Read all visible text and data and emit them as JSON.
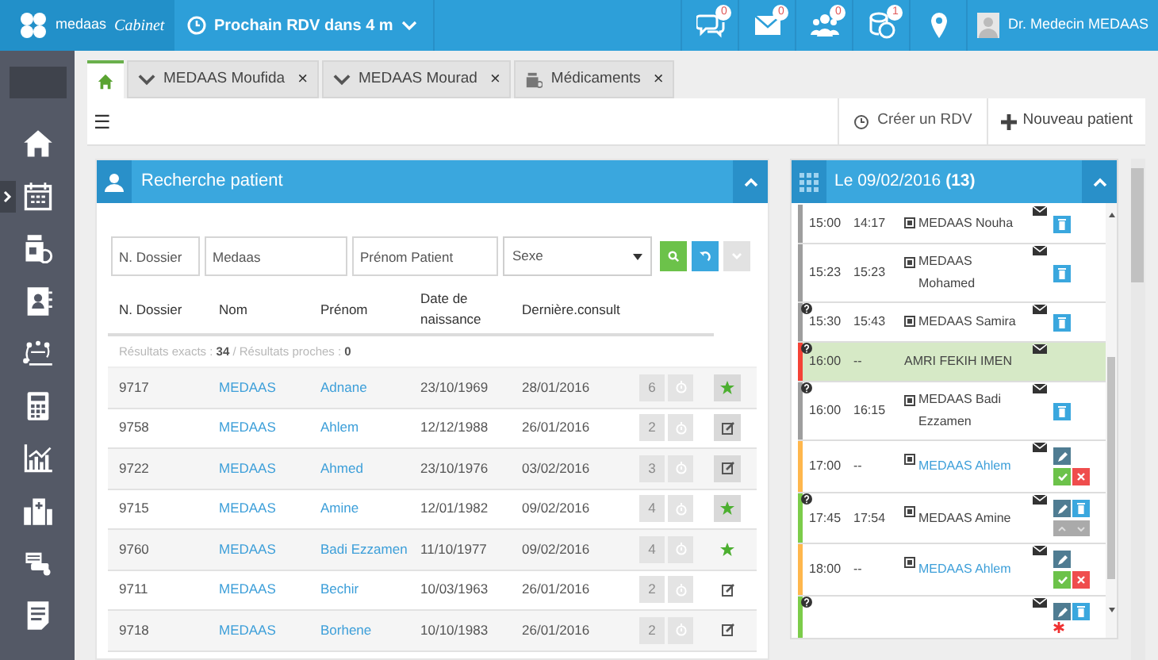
{
  "topbar": {
    "logo_text": "medaas",
    "logo_script": "Cabinet",
    "next_appointment": "Prochain RDV dans 4 m",
    "notifications": [
      {
        "kind": "chat",
        "count": "0"
      },
      {
        "kind": "mail",
        "count": "0"
      },
      {
        "kind": "group",
        "count": "0"
      },
      {
        "kind": "coins",
        "count": "1"
      },
      {
        "kind": "pin"
      }
    ],
    "user": "Dr. Medecin MEDAAS"
  },
  "tabs": [
    {
      "kind": "home",
      "selected": true
    },
    {
      "kind": "patient",
      "label": "MEDAAS Moufida",
      "close": "×",
      "selected": false
    },
    {
      "kind": "patient",
      "label": "MEDAAS Mourad",
      "close": "×",
      "selected": false
    },
    {
      "kind": "drug",
      "label": "Médicaments",
      "close": "×",
      "selected": false
    }
  ],
  "toolbar": {
    "menu": "☰",
    "create": "Créer un RDV",
    "new_patient": "Nouveau patient"
  },
  "search_panel": {
    "title": "Recherche patient",
    "fields": [
      {
        "placeholder": "N. Dossier"
      },
      {
        "value": "Medaas"
      },
      {
        "placeholder": "Prénom Patient"
      }
    ],
    "select": "Sexe",
    "columns": [
      "N. Dossier",
      "Nom",
      "Prénom",
      "Date de naissance",
      "Dernière.consult"
    ],
    "results": "Résultats exacts : **34** / Résultats proches : **0**",
    "rows": [
      {
        "dossier": "9717",
        "nom": "MEDAAS",
        "prenom": "Adnane",
        "naissance": "23/10/1969",
        "derniere": "28/01/2016",
        "visits": "6",
        "action": {
          "kind": "star",
          "framed": true
        }
      },
      {
        "dossier": "9758",
        "nom": "MEDAAS",
        "prenom": "Ahlem",
        "naissance": "12/12/1988",
        "derniere": "26/01/2016",
        "visits": "2",
        "action": {
          "kind": "edit",
          "framed": true
        }
      },
      {
        "dossier": "9722",
        "nom": "MEDAAS",
        "prenom": "Ahmed",
        "naissance": "23/10/1976",
        "derniere": "03/02/2016",
        "visits": "3",
        "action": {
          "kind": "edit",
          "framed": true
        }
      },
      {
        "dossier": "9715",
        "nom": "MEDAAS",
        "prenom": "Amine",
        "naissance": "12/01/1982",
        "derniere": "09/02/2016",
        "visits": "4",
        "action": {
          "kind": "star",
          "framed": true
        }
      },
      {
        "dossier": "9760",
        "nom": "MEDAAS",
        "prenom": "Badi Ezzamen",
        "naissance": "11/10/1977",
        "derniere": "09/02/2016",
        "visits": "4",
        "action": {
          "kind": "star",
          "framed": false
        }
      },
      {
        "dossier": "9711",
        "nom": "MEDAAS",
        "prenom": "Bechir",
        "naissance": "10/03/1963",
        "derniere": "26/01/2016",
        "visits": "2",
        "action": {
          "kind": "edit",
          "framed": false
        }
      },
      {
        "dossier": "9718",
        "nom": "MEDAAS",
        "prenom": "Borhene",
        "naissance": "10/10/1983",
        "derniere": "26/01/2016",
        "visits": "2",
        "action": {
          "kind": "edit",
          "framed": false
        }
      }
    ]
  },
  "agenda": {
    "title": "Le 09/02/2016 **(13)**",
    "rows": [
      {
        "time": "15:00",
        "arrival": "14:17",
        "patient": "MEDAAS Nouha",
        "file_icon": true,
        "link": false,
        "question": false,
        "highlighted": false,
        "color": "#9e9e9e",
        "actions": [
          {
            "kind": "trash"
          }
        ]
      },
      {
        "time": "15:23",
        "arrival": "15:23",
        "patient": "MEDAAS Mohamed",
        "file_icon": true,
        "link": false,
        "question": false,
        "highlighted": false,
        "color": "#9e9e9e",
        "actions": [
          {
            "kind": "trash"
          }
        ]
      },
      {
        "time": "15:30",
        "arrival": "15:43",
        "patient": "MEDAAS Samira",
        "file_icon": true,
        "link": false,
        "question": true,
        "highlighted": false,
        "color": "#9e9e9e",
        "actions": [
          {
            "kind": "trash"
          }
        ]
      },
      {
        "time": "16:00",
        "arrival": "--",
        "patient": "AMRI FEKIH IMEN",
        "file_icon": false,
        "link": false,
        "question": true,
        "highlighted": true,
        "color": "#f44336",
        "actions": []
      },
      {
        "time": "16:00",
        "arrival": "16:15",
        "patient": "MEDAAS Badi Ezzamen",
        "file_icon": true,
        "link": false,
        "question": true,
        "highlighted": false,
        "color": "#9e9e9e",
        "actions": [
          {
            "kind": "trash"
          }
        ]
      },
      {
        "time": "17:00",
        "arrival": "--",
        "patient": "MEDAAS Ahlem",
        "file_icon": true,
        "link": true,
        "question": false,
        "highlighted": false,
        "color": "#ffb74d",
        "actions": [
          {
            "kind": "edit"
          },
          {
            "kind": "newline"
          },
          {
            "kind": "check"
          },
          {
            "kind": "cancel"
          }
        ]
      },
      {
        "time": "17:45",
        "arrival": "17:54",
        "patient": "MEDAAS Amine",
        "file_icon": true,
        "link": false,
        "question": true,
        "highlighted": false,
        "color": "#7ccc4a",
        "actions": [
          {
            "kind": "edit"
          },
          {
            "kind": "trash"
          },
          {
            "kind": "newline"
          },
          {
            "kind": "updown"
          }
        ]
      },
      {
        "time": "18:00",
        "arrival": "--",
        "patient": "MEDAAS Ahlem",
        "file_icon": true,
        "link": true,
        "question": false,
        "highlighted": false,
        "color": "#ffb74d",
        "actions": [
          {
            "kind": "edit"
          },
          {
            "kind": "newline"
          },
          {
            "kind": "check"
          },
          {
            "kind": "cancel"
          }
        ]
      },
      {
        "question": true,
        "highlighted": false,
        "color": "#7ccc4a",
        "actions": [
          {
            "kind": "edit"
          },
          {
            "kind": "trash"
          },
          {
            "kind": "alert"
          }
        ]
      }
    ]
  }
}
